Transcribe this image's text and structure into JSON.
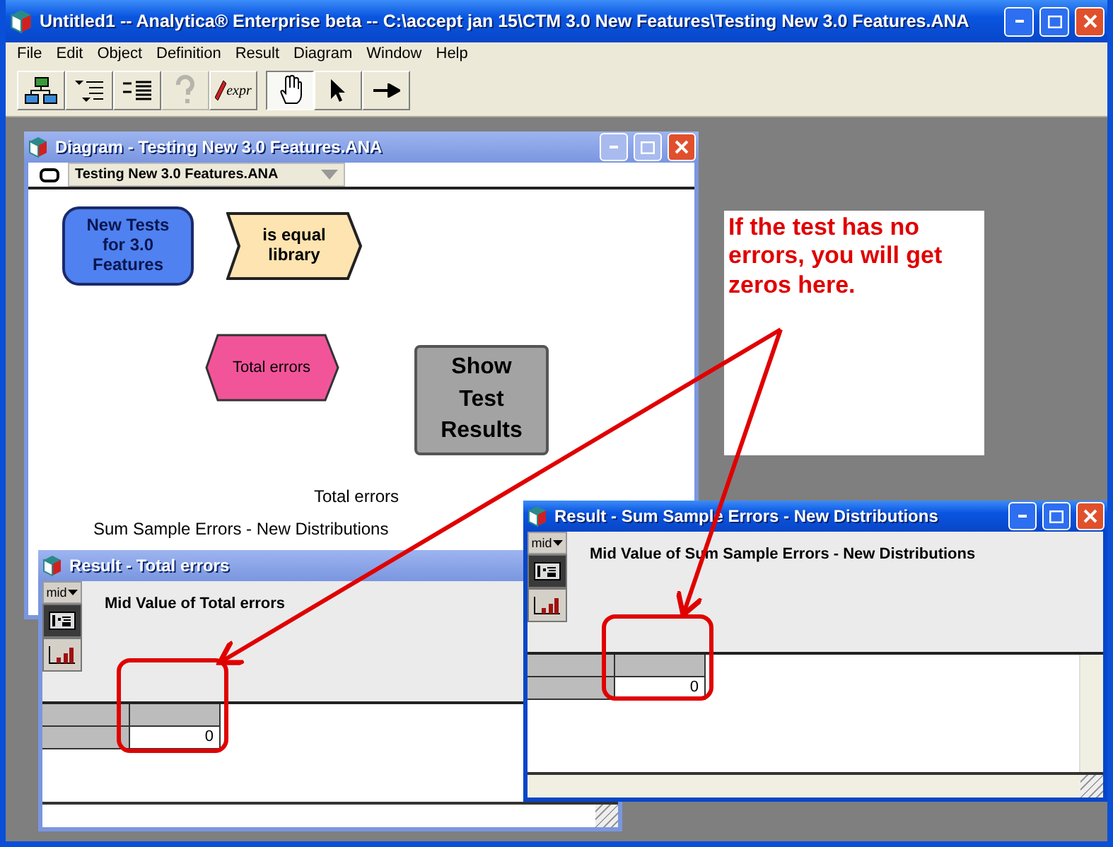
{
  "window": {
    "title": "Untitled1 -- Analytica® Enterprise beta -- C:\\accept jan 15\\CTM 3.0 New Features\\Testing New 3.0 Features.ANA"
  },
  "menu": [
    "File",
    "Edit",
    "Object",
    "Definition",
    "Result",
    "Diagram",
    "Window",
    "Help"
  ],
  "toolbar": [
    {
      "kind": "diagram",
      "selected": false,
      "disabled": false
    },
    {
      "kind": "outline",
      "selected": false,
      "disabled": false
    },
    {
      "kind": "attributes",
      "selected": false,
      "disabled": false
    },
    {
      "kind": "help",
      "selected": false,
      "disabled": true
    },
    {
      "kind": "expr",
      "label": "expr",
      "selected": false,
      "disabled": false
    },
    {
      "kind": "hand",
      "selected": true,
      "disabled": false
    },
    {
      "kind": "pointer",
      "selected": false,
      "disabled": false
    },
    {
      "kind": "arrow",
      "selected": false,
      "disabled": false
    }
  ],
  "diagram_window": {
    "title": "Diagram - Testing New 3.0 Features.ANA",
    "active": false,
    "module_selector": "Testing New 3.0 Features.ANA",
    "nodes": [
      {
        "kind": "module",
        "label": "New Tests for 3.0 Features"
      },
      {
        "kind": "library",
        "label": "is equal library"
      },
      {
        "kind": "objective",
        "label": "Total errors"
      },
      {
        "kind": "button",
        "label": "Show Test Results"
      }
    ],
    "labels": [
      "Total errors",
      "Sum Sample Errors - New Distributions"
    ]
  },
  "result_windows": [
    {
      "title": "Result - Total errors",
      "active": false,
      "mode": "mid",
      "heading": "Mid Value of Total errors",
      "value": "0"
    },
    {
      "title": "Result - Sum Sample Errors - New Distributions",
      "active": true,
      "mode": "mid",
      "heading": "Mid Value of Sum Sample Errors - New Distributions",
      "value": "0"
    }
  ],
  "annotation": {
    "text": "If the test has no errors, you will get zeros here."
  }
}
